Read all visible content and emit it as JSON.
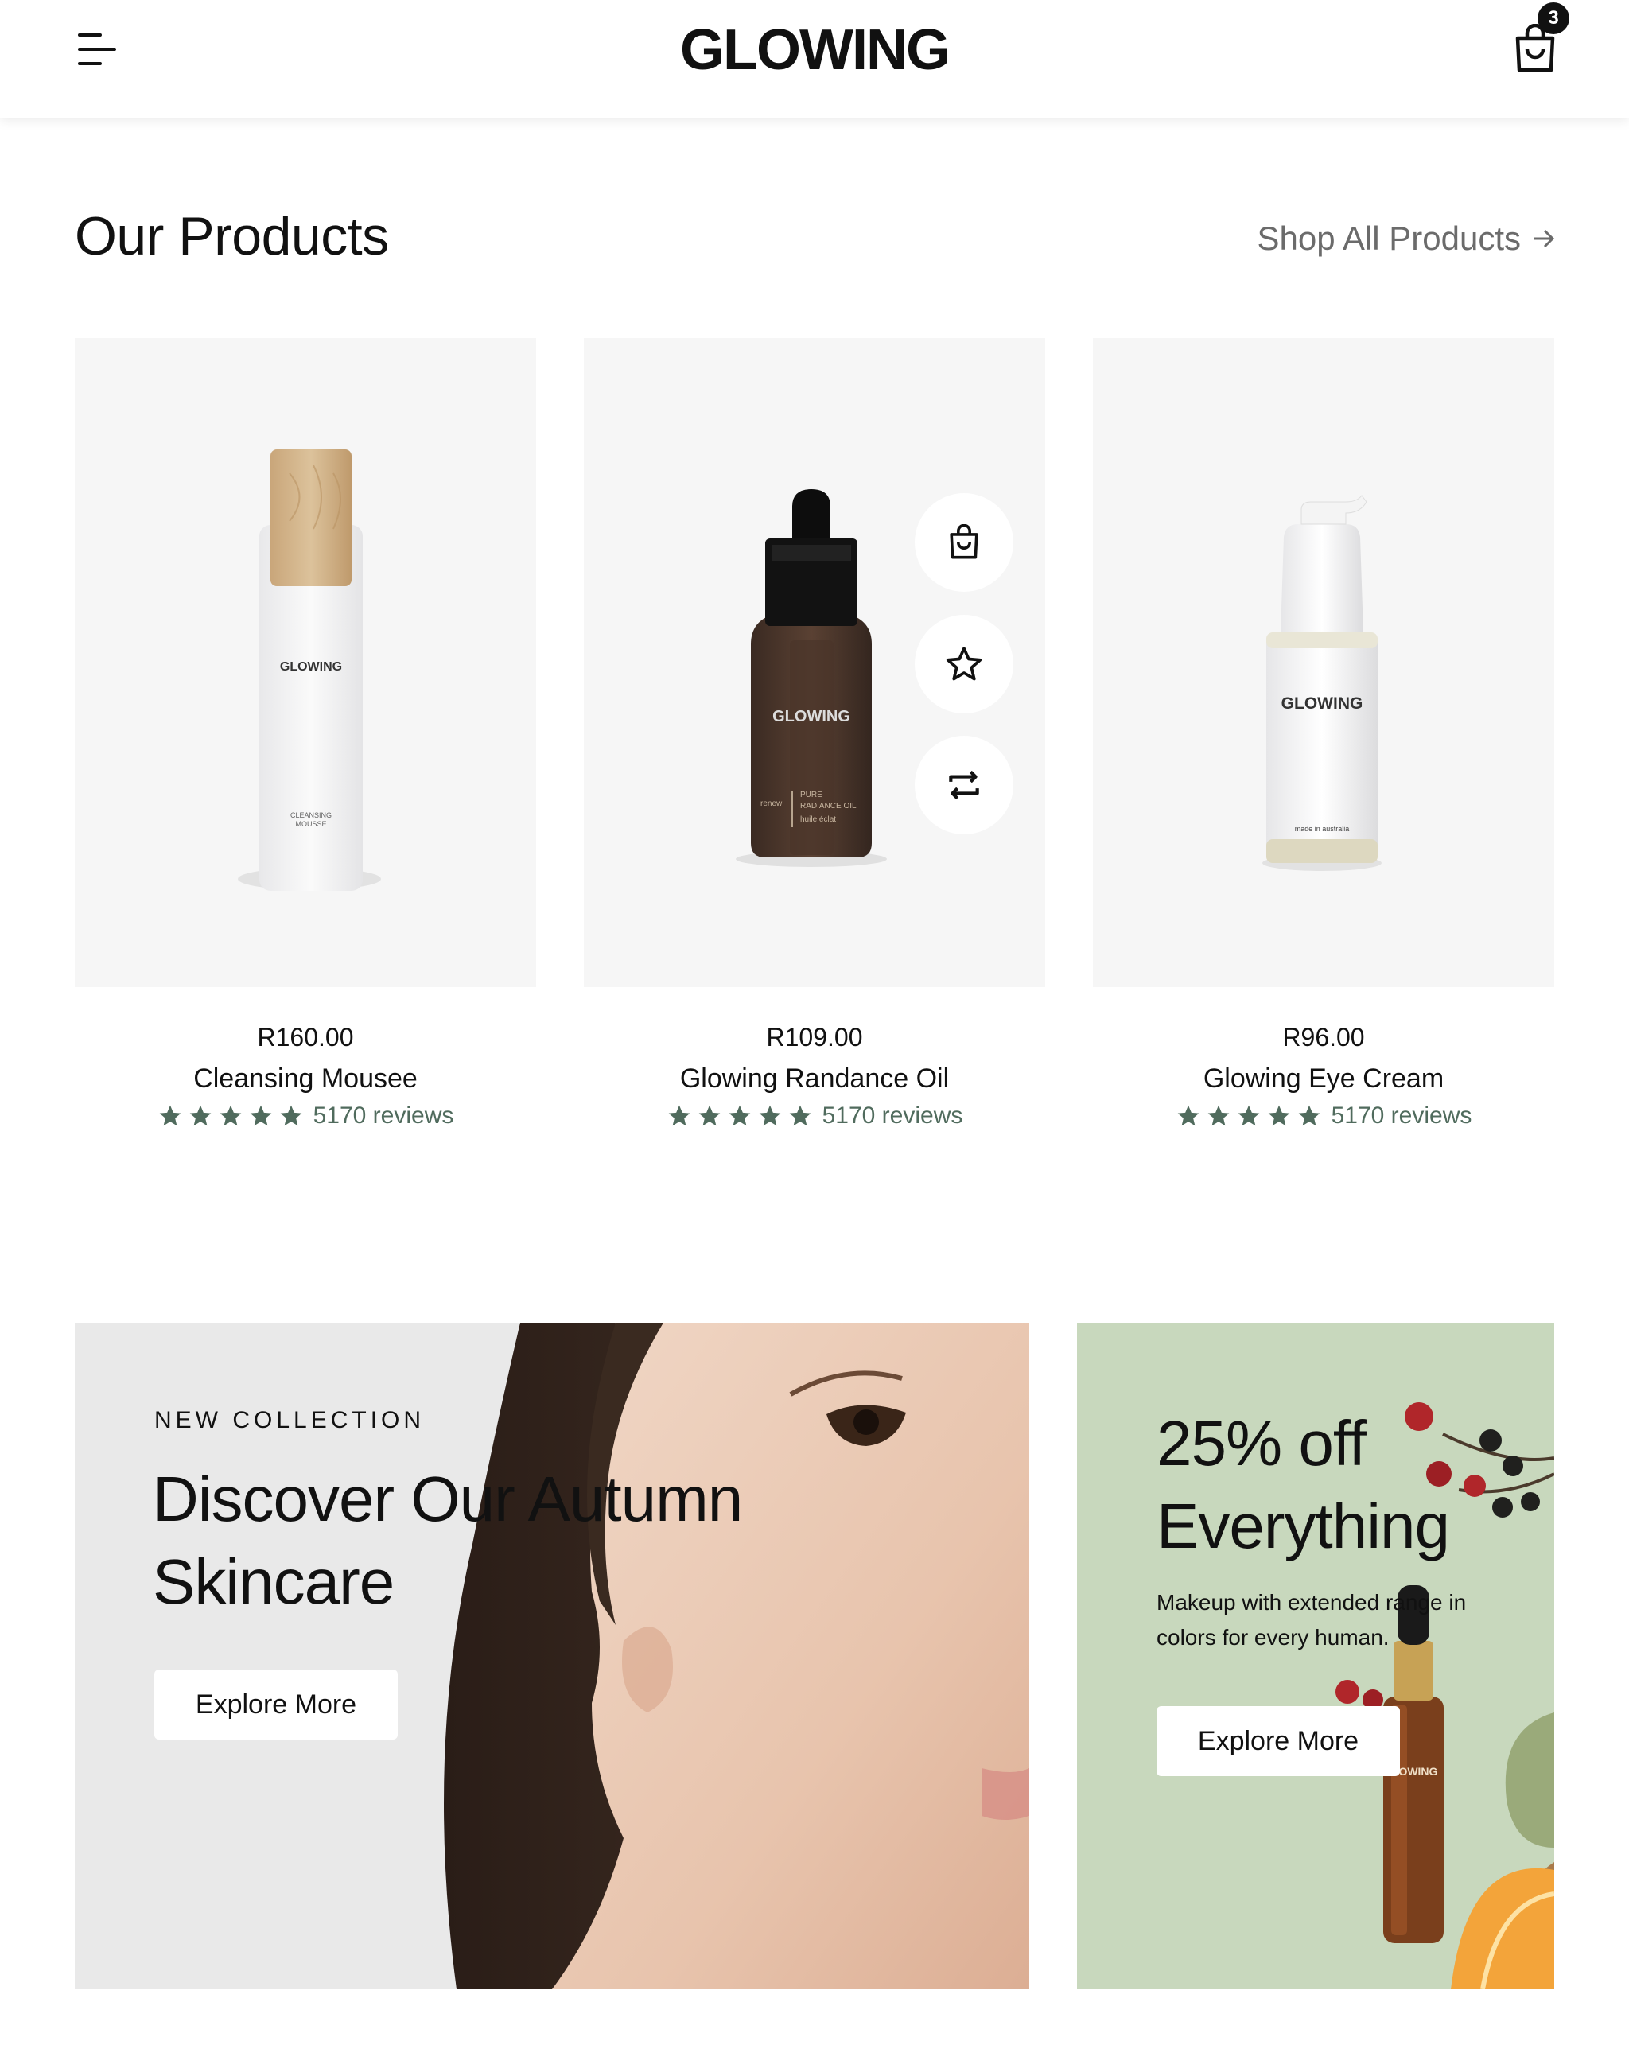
{
  "header": {
    "logo": "GLOWING",
    "cart_count": "3"
  },
  "section": {
    "title": "Our Products",
    "shop_all": "Shop All Products"
  },
  "products": [
    {
      "price": "R160.00",
      "name": "Cleansing Mousee",
      "rating": 5,
      "reviews": "5170 reviews",
      "label": "GLOWING",
      "sub_label": "CLEANSING MOUSSE"
    },
    {
      "price": "R109.00",
      "name": "Glowing Randance Oil",
      "rating": 5,
      "reviews": "5170 reviews",
      "label": "GLOWING",
      "sub_label": "PURE RADIANCE OIL",
      "sub_label_2": "renew",
      "sub_label_3": "huile éclat"
    },
    {
      "price": "R96.00",
      "name": "Glowing Eye Cream",
      "rating": 5,
      "reviews": "5170 reviews",
      "label": "GLOWING",
      "sub_label": "made in australia"
    }
  ],
  "banners": {
    "left": {
      "eyebrow": "NEW COLLECTION",
      "headline": "Discover Our Autumn Skincare",
      "button": "Explore More"
    },
    "right": {
      "headline": "25% off Everything",
      "subtext": "Makeup with extended range in colors for every human.",
      "button": "Explore More",
      "bottle_label": "GLOWING"
    }
  },
  "icons": {
    "menu": "menu-icon",
    "cart": "shopping-bag-icon",
    "arrow": "arrow-right-icon",
    "quick_add": "shopping-bag-icon",
    "wishlist": "star-outline-icon",
    "compare": "repeat-icon",
    "rating_star": "star-icon"
  },
  "colors": {
    "rating": "#506b5d",
    "card_bg": "#f6f6f6",
    "banner_green": "#c8d8bd",
    "banner_gray": "#e9e9e9"
  }
}
